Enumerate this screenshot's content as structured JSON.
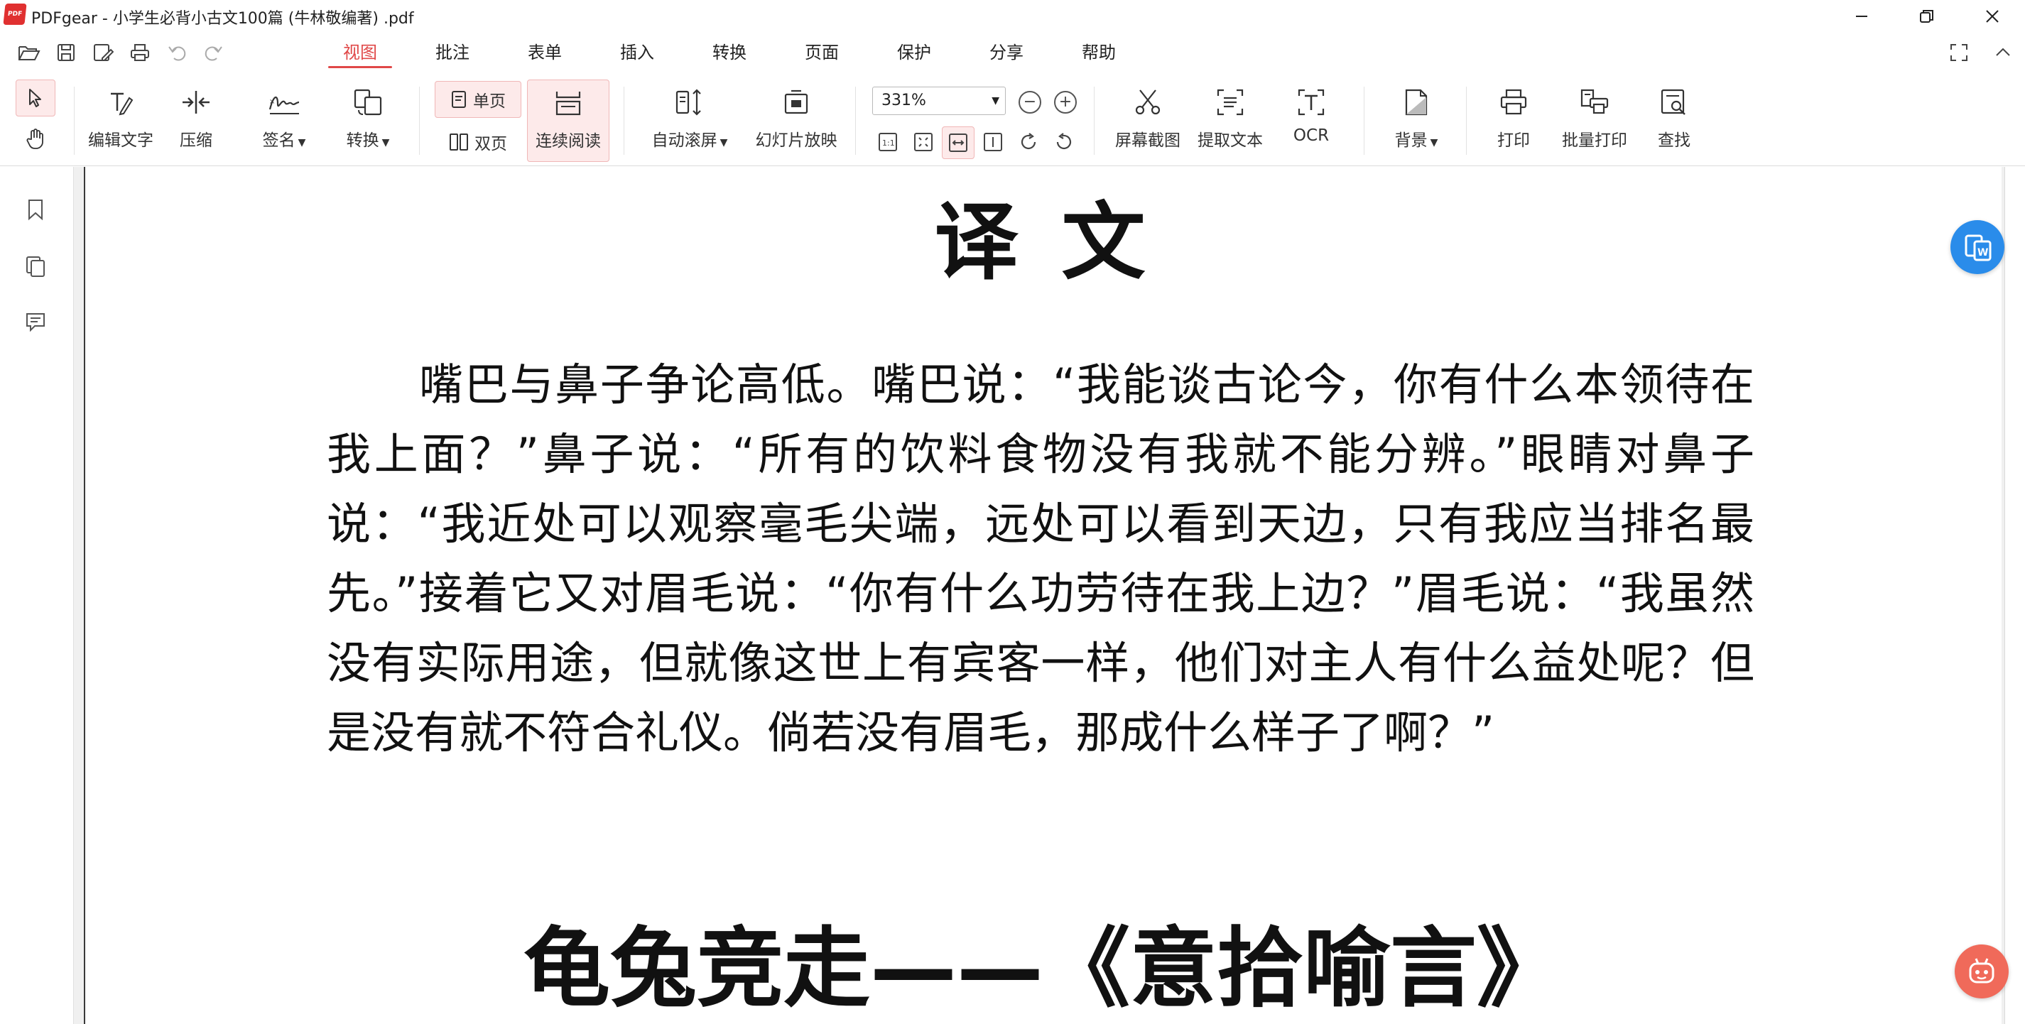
{
  "window": {
    "title": "PDFgear - 小学生必背小古文100篇 (牛林敬编著) .pdf",
    "logo_text": "PDF"
  },
  "menu": {
    "tabs": [
      {
        "label": "视图",
        "active": true
      },
      {
        "label": "批注"
      },
      {
        "label": "表单"
      },
      {
        "label": "插入"
      },
      {
        "label": "转换"
      },
      {
        "label": "页面"
      },
      {
        "label": "保护"
      },
      {
        "label": "分享"
      },
      {
        "label": "帮助"
      }
    ]
  },
  "toolbar": {
    "edit_text": "编辑文字",
    "compress": "压缩",
    "sign": "签名",
    "convert": "转换",
    "single_page": "单页",
    "double_page": "双页",
    "continuous": "连续阅读",
    "auto_scroll": "自动滚屏",
    "slideshow": "幻灯片放映",
    "zoom": "331%",
    "screenshot": "屏幕截图",
    "extract_text": "提取文本",
    "ocr": "OCR",
    "background": "背景",
    "print": "打印",
    "batch_print": "批量打印",
    "search": "查找"
  },
  "document": {
    "heading": "译 文",
    "body": "嘴巴与鼻子争论高低。嘴巴说：“我能谈古论今，你有什么本领待在我上面？”鼻子说：“所有的饮料食物没有我就不能分辨。”眼睛对鼻子说：“我近处可以观察毫毛尖端，远处可以看到天边，只有我应当排名最先。”接着它又对眉毛说：“你有什么功劳待在我上边？”眉毛说：“我虽然没有实际用途，但就像这世上有宾客一样，他们对主人有什么益处呢？但是没有就不符合礼仪。倘若没有眉毛，那成什么样子了啊？”",
    "next_heading": "龟兔竞走——《意拾喻言》"
  },
  "colors": {
    "accent": "#e04848",
    "convert_button": "#2a8cea",
    "assistant_button": "#f06a5a"
  }
}
